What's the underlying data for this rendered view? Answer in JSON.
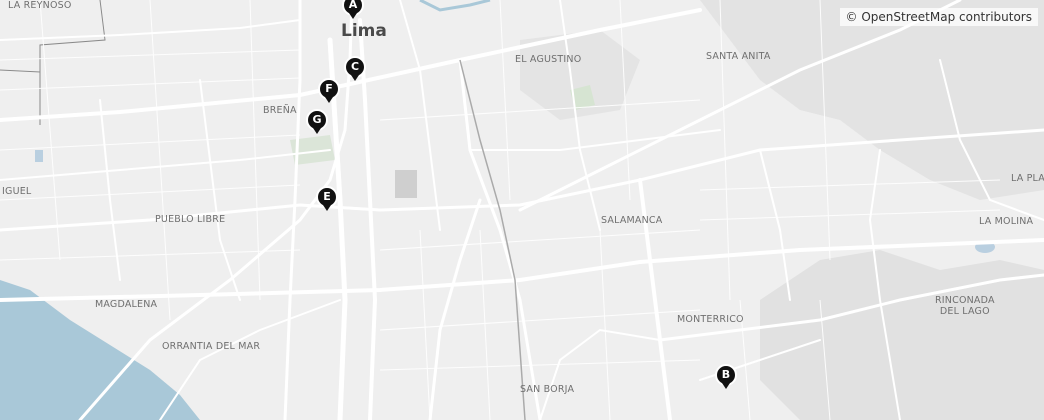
{
  "map": {
    "attribution": "© OpenStreetMap contributors",
    "colors": {
      "land": "#efefef",
      "water": "#a9c8d8",
      "road": "#ffffff",
      "hill": "#e2e2e2",
      "park": "#d9e6d5",
      "boundary": "#888888",
      "marker": "#111111"
    },
    "labels": {
      "lima": "Lima",
      "la_reynoso": "LA REYNOSO",
      "el_agustino": "EL AGUSTINO",
      "santa_anita": "SANTA ANITA",
      "brena": "BREÑA",
      "miguel": "IGUEL",
      "pueblo_libre": "PUEBLO LIBRE",
      "salamanca": "SALAMANCA",
      "la_plan": "LA PLAN",
      "la_molina": "LA MOLINA",
      "magdalena": "MAGDALENA",
      "orrantia": "ORRANTIA DEL MAR",
      "monterrico": "MONTERRICO",
      "rinconada": "RINCONADA\nDEL LAGO",
      "san_borja": "SAN BORJA"
    },
    "markers": [
      {
        "letter": "A"
      },
      {
        "letter": "B"
      },
      {
        "letter": "C"
      },
      {
        "letter": "E"
      },
      {
        "letter": "F"
      },
      {
        "letter": "G"
      }
    ]
  }
}
